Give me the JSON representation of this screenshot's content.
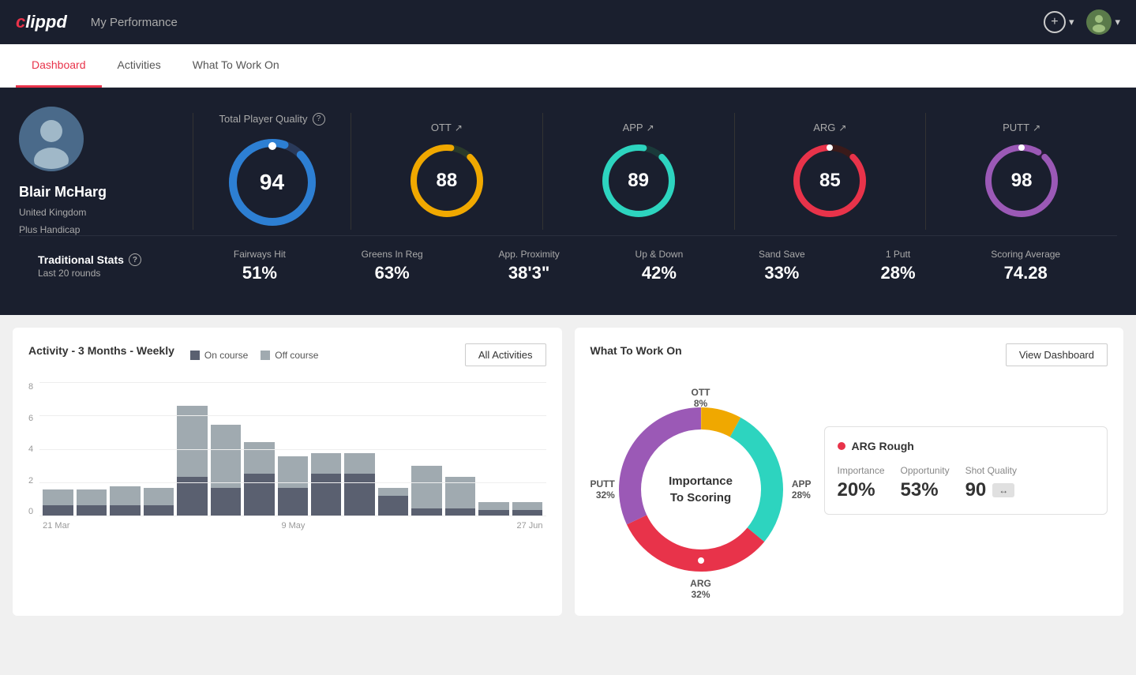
{
  "app": {
    "logo": "clippd",
    "logo_c": "c",
    "logo_rest": "lippd",
    "header_title": "My Performance"
  },
  "nav": {
    "tabs": [
      {
        "label": "Dashboard",
        "active": true
      },
      {
        "label": "Activities",
        "active": false
      },
      {
        "label": "What To Work On",
        "active": false
      }
    ]
  },
  "player": {
    "name": "Blair McHarg",
    "country": "United Kingdom",
    "handicap": "Plus Handicap"
  },
  "scores": {
    "total_quality_label": "Total Player Quality",
    "total": 94,
    "items": [
      {
        "label": "OTT",
        "value": 88,
        "color": "#f0a800",
        "bg_color": "#2a2f3e",
        "track": "#333"
      },
      {
        "label": "APP",
        "value": 89,
        "color": "#2dd4bf",
        "bg_color": "#2a2f3e",
        "track": "#333"
      },
      {
        "label": "ARG",
        "value": 85,
        "color": "#e8334a",
        "bg_color": "#2a2f3e",
        "track": "#333"
      },
      {
        "label": "PUTT",
        "value": 98,
        "color": "#9b59b6",
        "bg_color": "#2a2f3e",
        "track": "#333"
      }
    ]
  },
  "traditional_stats": {
    "title": "Traditional Stats",
    "subtitle": "Last 20 rounds",
    "items": [
      {
        "label": "Fairways Hit",
        "value": "51%"
      },
      {
        "label": "Greens In Reg",
        "value": "63%"
      },
      {
        "label": "App. Proximity",
        "value": "38'3\""
      },
      {
        "label": "Up & Down",
        "value": "42%"
      },
      {
        "label": "Sand Save",
        "value": "33%"
      },
      {
        "label": "1 Putt",
        "value": "28%"
      },
      {
        "label": "Scoring Average",
        "value": "74.28"
      }
    ]
  },
  "activity_chart": {
    "title": "Activity - 3 Months - Weekly",
    "legend": {
      "on_course": "On course",
      "off_course": "Off course"
    },
    "all_activities_btn": "All Activities",
    "y_labels": [
      "8",
      "6",
      "4",
      "2",
      "0"
    ],
    "x_labels": [
      "21 Mar",
      "9 May",
      "27 Jun"
    ],
    "bars": [
      {
        "on": 15,
        "off": 20
      },
      {
        "on": 15,
        "off": 20
      },
      {
        "on": 15,
        "off": 25
      },
      {
        "on": 15,
        "off": 25
      },
      {
        "on": 55,
        "off": 90
      },
      {
        "on": 35,
        "off": 80
      },
      {
        "on": 55,
        "off": 40
      },
      {
        "on": 35,
        "off": 40
      },
      {
        "on": 55,
        "off": 25
      },
      {
        "on": 55,
        "off": 25
      },
      {
        "on": 25,
        "off": 10
      },
      {
        "on": 10,
        "off": 55
      },
      {
        "on": 10,
        "off": 40
      },
      {
        "on": 10,
        "off": 10
      },
      {
        "on": 10,
        "off": 10
      }
    ]
  },
  "what_to_work_on": {
    "title": "What To Work On",
    "view_dashboard_btn": "View Dashboard",
    "donut": {
      "center_line1": "Importance",
      "center_line2": "To Scoring",
      "segments": [
        {
          "label": "OTT",
          "percent": "8%",
          "color": "#f0a800",
          "value": 8
        },
        {
          "label": "APP",
          "percent": "28%",
          "color": "#2dd4bf",
          "value": 28
        },
        {
          "label": "ARG",
          "percent": "32%",
          "color": "#e8334a",
          "value": 32
        },
        {
          "label": "PUTT",
          "percent": "32%",
          "color": "#9b59b6",
          "value": 32
        }
      ]
    },
    "detail": {
      "title": "ARG Rough",
      "dot_color": "#e8334a",
      "metrics": [
        {
          "label": "Importance",
          "value": "20%"
        },
        {
          "label": "Opportunity",
          "value": "53%"
        },
        {
          "label": "Shot Quality",
          "value": "90",
          "badge": true
        }
      ]
    }
  }
}
